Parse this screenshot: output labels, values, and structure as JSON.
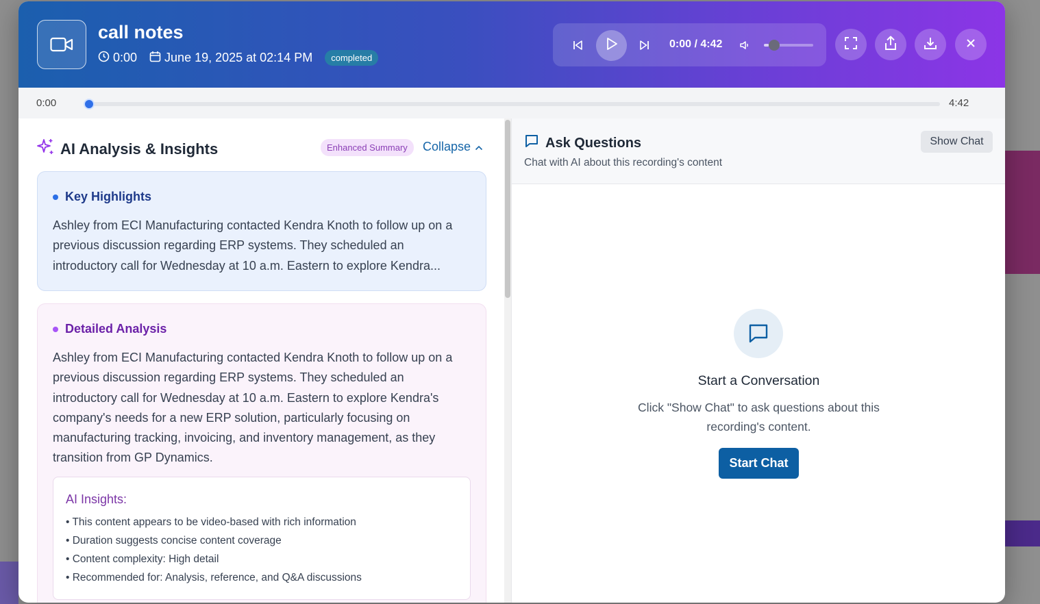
{
  "header": {
    "title": "call notes",
    "duration": "0:00",
    "date": "June 19, 2025 at 02:14 PM",
    "status": "completed",
    "player": {
      "time_readout": "0:00 / 4:42",
      "volume_level": 0.1
    },
    "icons": [
      "video-camera-icon",
      "clock-icon",
      "calendar-icon",
      "skip-back-icon",
      "play-icon",
      "skip-forward-icon",
      "volume-icon",
      "fullscreen-icon",
      "share-icon",
      "download-icon",
      "close-icon"
    ]
  },
  "progress": {
    "current": "0:00",
    "total": "4:42",
    "fraction": 0
  },
  "analysis": {
    "title": "AI Analysis & Insights",
    "badge": "Enhanced Summary",
    "collapse_label": "Collapse",
    "highlights": {
      "heading": "Key Highlights",
      "text": "Ashley from ECI Manufacturing contacted Kendra Knoth to follow up on a previous discussion regarding ERP systems. They scheduled an introductory call for Wednesday at 10 a.m. Eastern to explore Kendra..."
    },
    "detailed": {
      "heading": "Detailed Analysis",
      "text": "Ashley from ECI Manufacturing contacted Kendra Knoth to follow up on a previous discussion regarding ERP systems. They scheduled an introductory call for Wednesday at 10 a.m. Eastern to explore Kendra's company's needs for a new ERP solution, particularly focusing on manufacturing tracking, invoicing, and inventory management, as they transition from GP Dynamics."
    },
    "insights": {
      "title": "AI Insights:",
      "items": [
        "• This content appears to be video-based with rich information",
        "• Duration suggests concise content coverage",
        "• Content complexity: High detail",
        "• Recommended for: Analysis, reference, and Q&A discussions"
      ]
    }
  },
  "chat": {
    "title": "Ask Questions",
    "subtitle": "Chat with AI about this recording's content",
    "show_chat_label": "Show Chat",
    "empty_title": "Start a Conversation",
    "empty_text": "Click \"Show Chat\" to ask questions about this recording's content.",
    "start_label": "Start Chat"
  },
  "colors": {
    "accent": "#2b6fe6",
    "primary_button": "#0d5fa3",
    "highlights_heading": "#1e3a8a",
    "detailed_heading": "#6b21a8",
    "status_badge": "#1ea096"
  }
}
